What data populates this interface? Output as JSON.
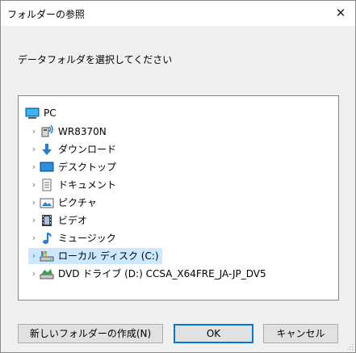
{
  "window": {
    "title": "フォルダーの参照",
    "close_glyph": "✕"
  },
  "prompt": "データフォルダを選択してください",
  "tree": {
    "root": {
      "label": "PC",
      "icon": "pc-icon"
    },
    "items": [
      {
        "label": "WR8370N",
        "icon": "network-device-icon",
        "name": "tree-item-wr8370n"
      },
      {
        "label": "ダウンロード",
        "icon": "download-arrow-icon",
        "name": "tree-item-downloads"
      },
      {
        "label": "デスクトップ",
        "icon": "desktop-icon",
        "name": "tree-item-desktop"
      },
      {
        "label": "ドキュメント",
        "icon": "documents-icon",
        "name": "tree-item-documents"
      },
      {
        "label": "ピクチャ",
        "icon": "pictures-icon",
        "name": "tree-item-pictures"
      },
      {
        "label": "ビデオ",
        "icon": "videos-icon",
        "name": "tree-item-videos"
      },
      {
        "label": "ミュージック",
        "icon": "music-note-icon",
        "name": "tree-item-music"
      },
      {
        "label": "ローカル ディスク (C:)",
        "icon": "local-disk-icon",
        "name": "tree-item-local-disk-c",
        "selected": true
      },
      {
        "label": "DVD ドライブ (D:) CCSA_X64FRE_JA-JP_DV5",
        "icon": "dvd-drive-icon",
        "name": "tree-item-dvd-drive-d"
      }
    ]
  },
  "buttons": {
    "new_folder": "新しいフォルダーの作成(N)",
    "ok": "OK",
    "cancel": "キャンセル"
  },
  "colors": {
    "selection": "#cce8ff",
    "accent": "#0078d7"
  }
}
